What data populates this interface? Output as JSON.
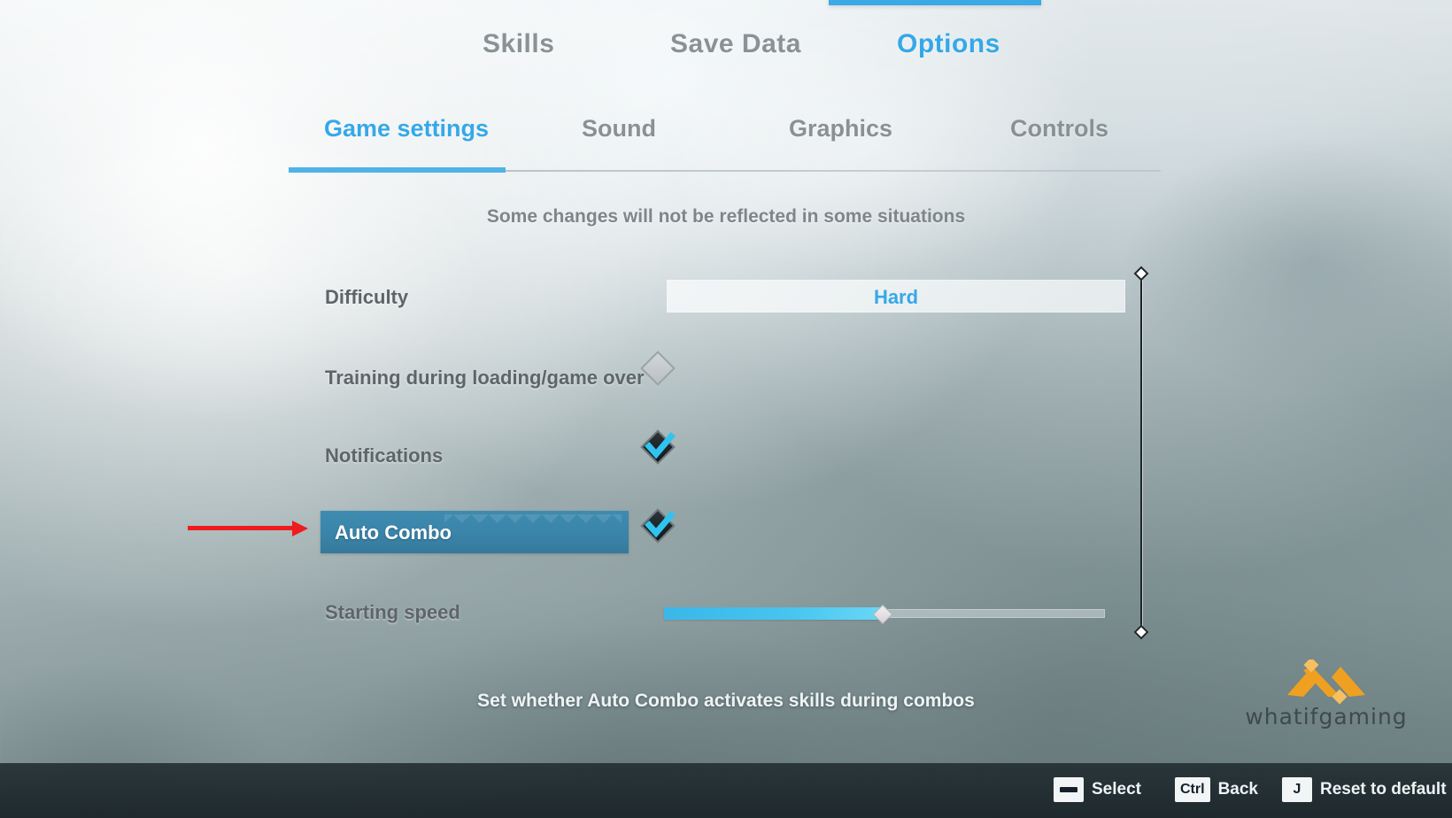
{
  "screen": {
    "title": "Options",
    "notice": "Some changes will not be reflected in some situations",
    "description": "Set whether Auto Combo activates skills during combos"
  },
  "top_nav": {
    "items": [
      {
        "label": "Skills",
        "active": false
      },
      {
        "label": "Save Data",
        "active": false
      },
      {
        "label": "Options",
        "active": true
      }
    ]
  },
  "sub_tabs": {
    "items": [
      {
        "label": "Game settings",
        "active": true
      },
      {
        "label": "Sound",
        "active": false
      },
      {
        "label": "Graphics",
        "active": false
      },
      {
        "label": "Controls",
        "active": false
      }
    ]
  },
  "options": {
    "difficulty": {
      "label": "Difficulty",
      "value": "Hard"
    },
    "training": {
      "label": "Training during loading/game over",
      "checked": "off"
    },
    "notifications": {
      "label": "Notifications",
      "checked": "on"
    },
    "auto_combo": {
      "label": "Auto Combo",
      "checked": "on",
      "selected": "true"
    },
    "starting_speed": {
      "label": "Starting speed",
      "fill_percent": "50"
    }
  },
  "scrollbar": {
    "position": "top"
  },
  "hints": [
    {
      "key": "spacebar",
      "key_label": "",
      "label": "Select"
    },
    {
      "key": "ctrl",
      "key_label": "Ctrl",
      "label": "Back"
    },
    {
      "key": "j",
      "key_label": "J",
      "label": "Reset to default"
    }
  ],
  "watermark": {
    "text": "whatifgaming",
    "logo_color": "#f0a020"
  },
  "colors": {
    "accent_blue": "#35a8e8",
    "highlight_row": "#3a84a9",
    "slider_fill": "#46c4ee",
    "annotation_red": "#ee1c1c"
  }
}
